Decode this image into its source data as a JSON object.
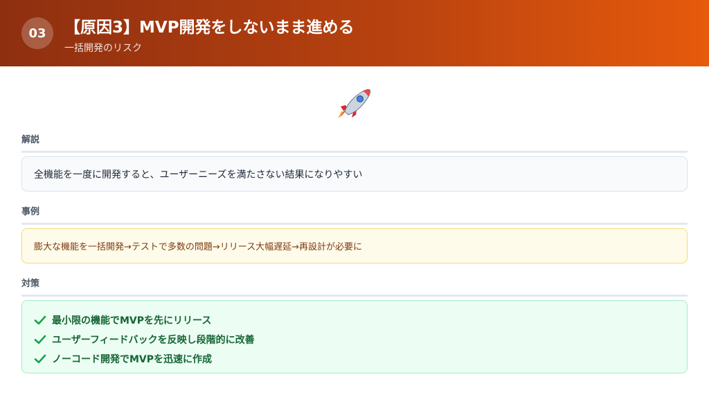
{
  "header": {
    "number": "03",
    "title": "【原因3】MVP開発をしないまま進める",
    "subtitle": "一括開発のリスク",
    "gradient_start": "#8e2f10",
    "gradient_end": "#e65a0c"
  },
  "hero_icon": "rocket-icon",
  "sections": {
    "explain": {
      "label": "解説",
      "text": "全機能を一度に開発すると、ユーザーニーズを満たさない結果になりやすい"
    },
    "case": {
      "label": "事例",
      "text": "膨大な機能を一括開発→テストで多数の問題→リリース大幅遅延→再設計が必要に"
    },
    "measures": {
      "label": "対策",
      "items": [
        "最小限の機能でMVPを先にリリース",
        "ユーザーフィードバックを反映し段階的に改善",
        "ノーコード開発でMVPを迅速に作成"
      ],
      "check_color": "#16a34a"
    }
  }
}
